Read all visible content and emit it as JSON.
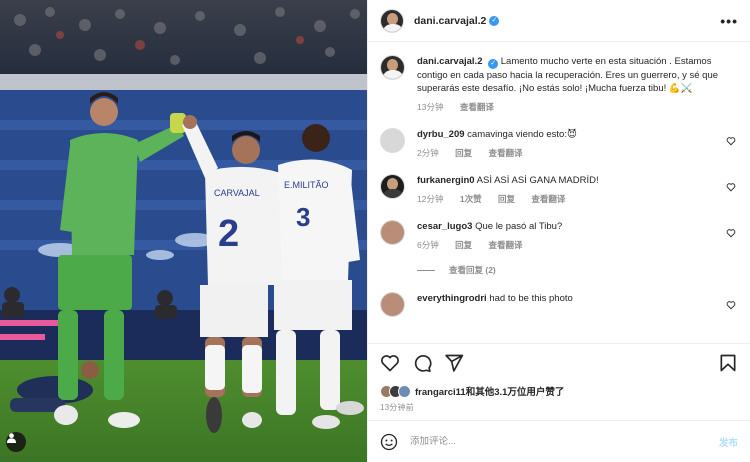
{
  "post": {
    "author": "dani.carvajal.2",
    "more_label": "•••"
  },
  "caption": {
    "username": "dani.carvajal.2",
    "text": "Lamento mucho verte en esta situación . Estamos contigo en cada paso hacia la recuperación. Eres un guerrero, y sé que superarás este desafío. ¡No estás solo! ¡Mucha fuerza tibu! 💪⚔️",
    "time": "13分钟",
    "translate": "查看翻译"
  },
  "comments": [
    {
      "username": "dyrbu_209",
      "text": "camavinga viendo esto:😈",
      "time": "2分钟",
      "reply": "回复",
      "likes": "",
      "translate": "查看翻译"
    },
    {
      "username": "furkanergin0",
      "text": "ASİ ASİ ASİ GANA MADRİD!",
      "time": "12分钟",
      "reply": "回复",
      "likes": "1次赞",
      "translate": "查看翻译"
    },
    {
      "username": "cesar_lugo3",
      "text": "Que le pasó al Tibu?",
      "time": "6分钟",
      "reply": "回复",
      "likes": "",
      "translate": "查看翻译"
    }
  ],
  "view_replies": "查看回复 (2)",
  "partial_comment": {
    "username": "everythingrodri",
    "text": "had to be this photo"
  },
  "likes": {
    "text": "frangarci11和其他3.1万位用户赞了",
    "posted": "13分钟前"
  },
  "add_comment": {
    "placeholder": "添加评论...",
    "post_label": "发布"
  },
  "photo": {
    "jersey_left_name": "CARVAJAL",
    "jersey_left_number": "2",
    "jersey_right_name": "E.MILITÃO",
    "jersey_right_number": "3"
  },
  "colors": {
    "verified": "#3897f0",
    "post_button": "#b2dffc",
    "muted": "#8e8e8e",
    "stadium_blue": "#2a4c8f"
  }
}
